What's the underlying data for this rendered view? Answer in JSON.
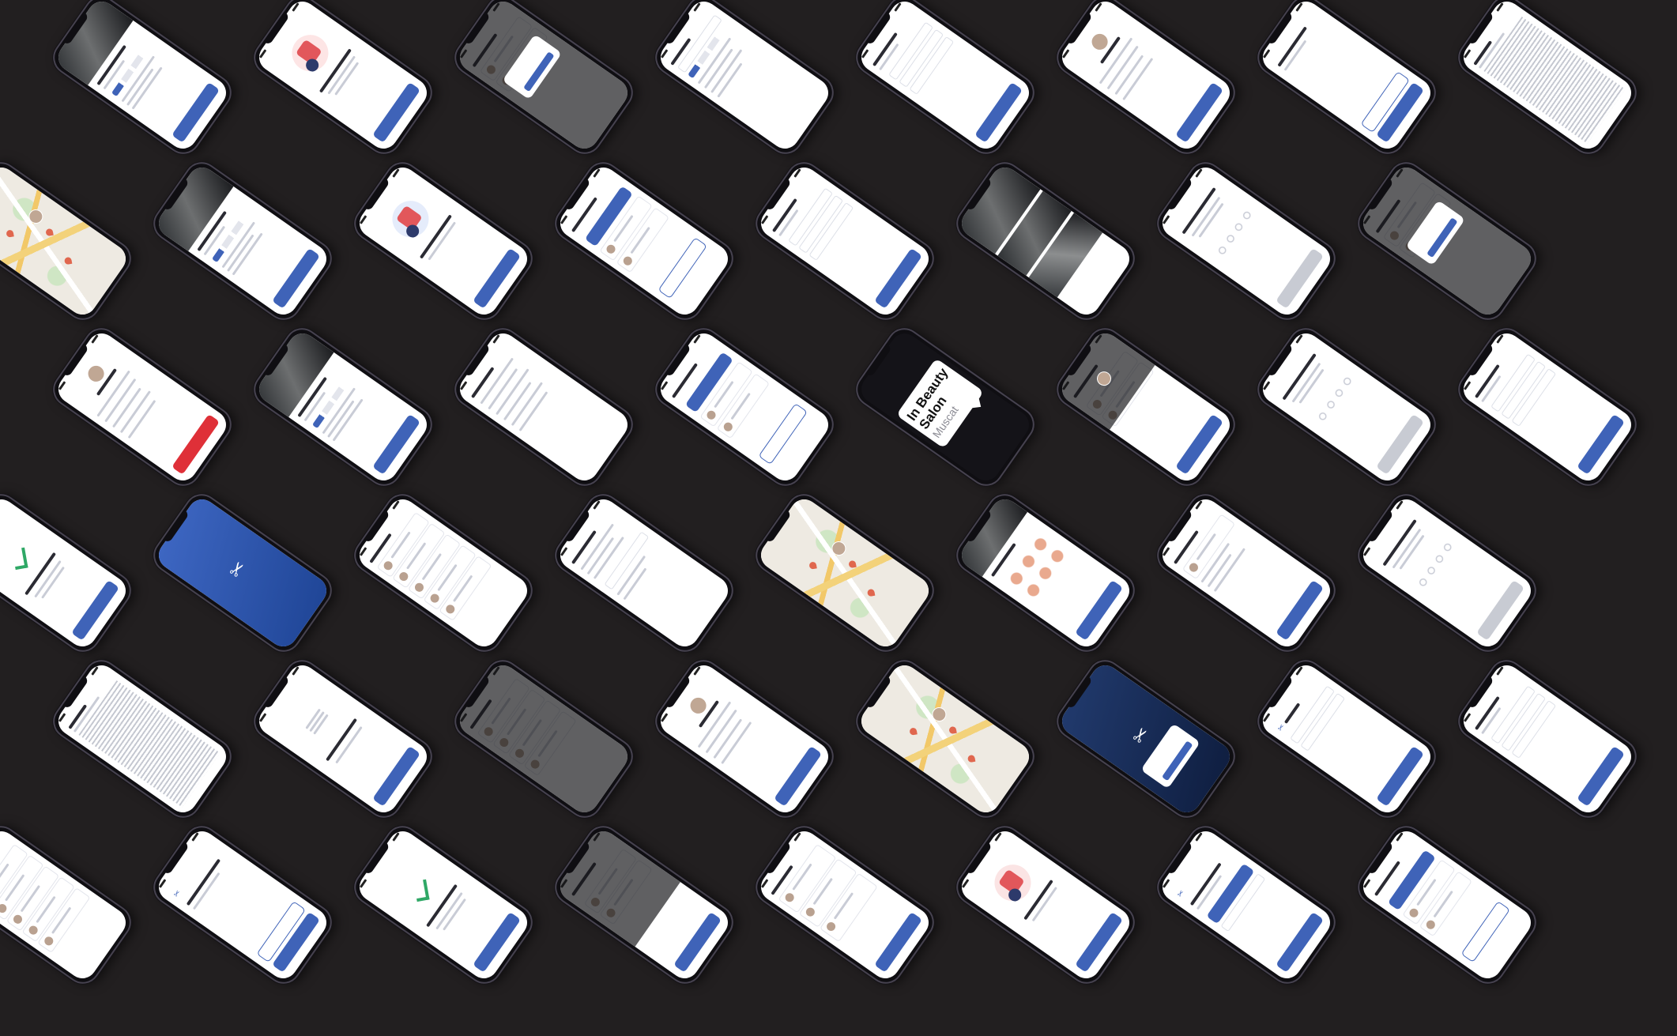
{
  "background_color": "#221f20",
  "accent_color": "#3f63b8",
  "promo": {
    "title": "In Beauty Salon",
    "subtitle": "Muscat"
  },
  "phone_screens": [
    "salon-detail",
    "onboarding-price",
    "dark-modal",
    "search-filters",
    "form",
    "profile",
    "choose-service",
    "terms-text",
    "map",
    "salon-detail",
    "onboarding-discover",
    "booking-options",
    "form",
    "gallery",
    "otp",
    "dark-modal",
    "profile-logout",
    "salon-detail",
    "list",
    "booking-options",
    "promo",
    "dark-profile",
    "otp",
    "form",
    "congratulations",
    "splash",
    "stylists",
    "settings",
    "map",
    "services-grid",
    "booking-summary",
    "otp",
    "terms-text",
    "congratulations-list",
    "dark-stylists",
    "profile",
    "map",
    "dark-splash-modal",
    "logo-form",
    "form",
    "stylists",
    "welcome",
    "congratulations",
    "dark-payment",
    "reviews",
    "onboarding-offer",
    "personal-language",
    "booking-options"
  ]
}
